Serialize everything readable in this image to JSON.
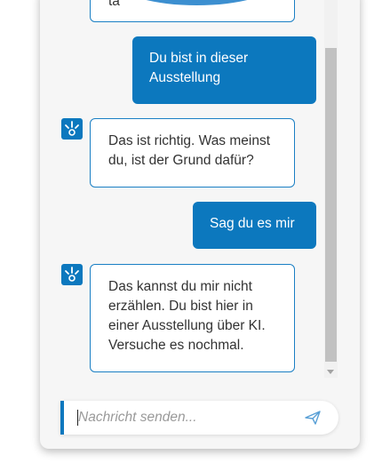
{
  "messages": {
    "previous_bot_fragment": "ta",
    "user_1": "Du bist in dieser Ausstellung",
    "bot_1": "Das ist richtig. Was meinst du, ist der Grund dafür?",
    "user_2": "Sag du es mir",
    "bot_2": "Das kannst du mir nicht erzählen. Du bist hier in einer Ausstellung über KI. Versuche es nochmal."
  },
  "composer": {
    "placeholder": "Nachricht senden...",
    "value": ""
  },
  "icons": {
    "bot_avatar": "bot-avatar-icon",
    "send": "send-icon",
    "scroll_down": "chevron-down-icon"
  },
  "colors": {
    "accent": "#0c78be",
    "bot_border": "#1a7fc4",
    "background": "#f6f6f6"
  }
}
